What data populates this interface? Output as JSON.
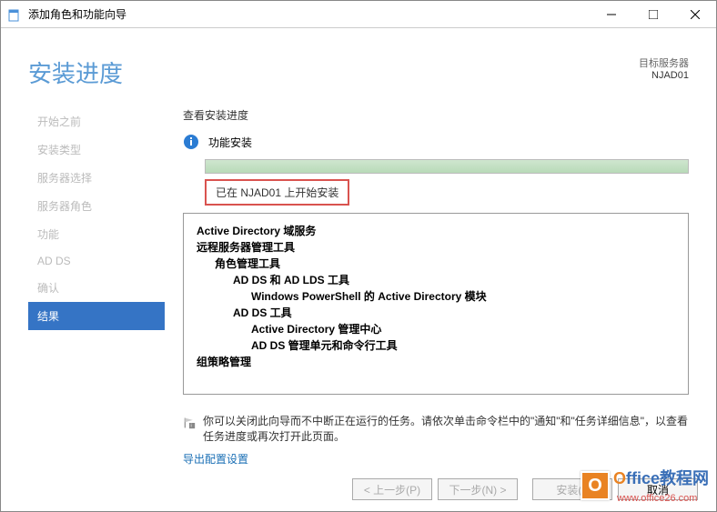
{
  "window": {
    "title": "添加角色和功能向导"
  },
  "header": {
    "pageTitle": "安装进度",
    "serverLabel": "目标服务器",
    "serverName": "NJAD01"
  },
  "sidebar": {
    "steps": [
      "开始之前",
      "安装类型",
      "服务器选择",
      "服务器角色",
      "功能",
      "AD DS",
      "确认",
      "结果"
    ]
  },
  "content": {
    "sectionTitle": "查看安装进度",
    "statusText": "功能安装",
    "highlightText": "已在 NJAD01 上开始安装",
    "tree": {
      "l0a": "Active Directory 域服务",
      "l0b": "远程服务器管理工具",
      "l1a": "角色管理工具",
      "l2a": "AD DS 和 AD LDS 工具",
      "l3a": "Windows PowerShell 的 Active Directory 模块",
      "l2b": "AD DS 工具",
      "l3b": "Active Directory 管理中心",
      "l3c": "AD DS 管理单元和命令行工具",
      "l0c": "组策略管理"
    },
    "hint": "你可以关闭此向导而不中断正在运行的任务。请依次单击命令栏中的\"通知\"和\"任务详细信息\"，以查看任务进度或再次打开此页面。",
    "exportLink": "导出配置设置"
  },
  "footer": {
    "prev": "< 上一步(P)",
    "next": "下一步(N) >",
    "install": "安装(I)",
    "cancel": "取消"
  },
  "watermark": {
    "brandO": "O",
    "brandRest": "ffice教程网",
    "url": "www.office26.com"
  }
}
